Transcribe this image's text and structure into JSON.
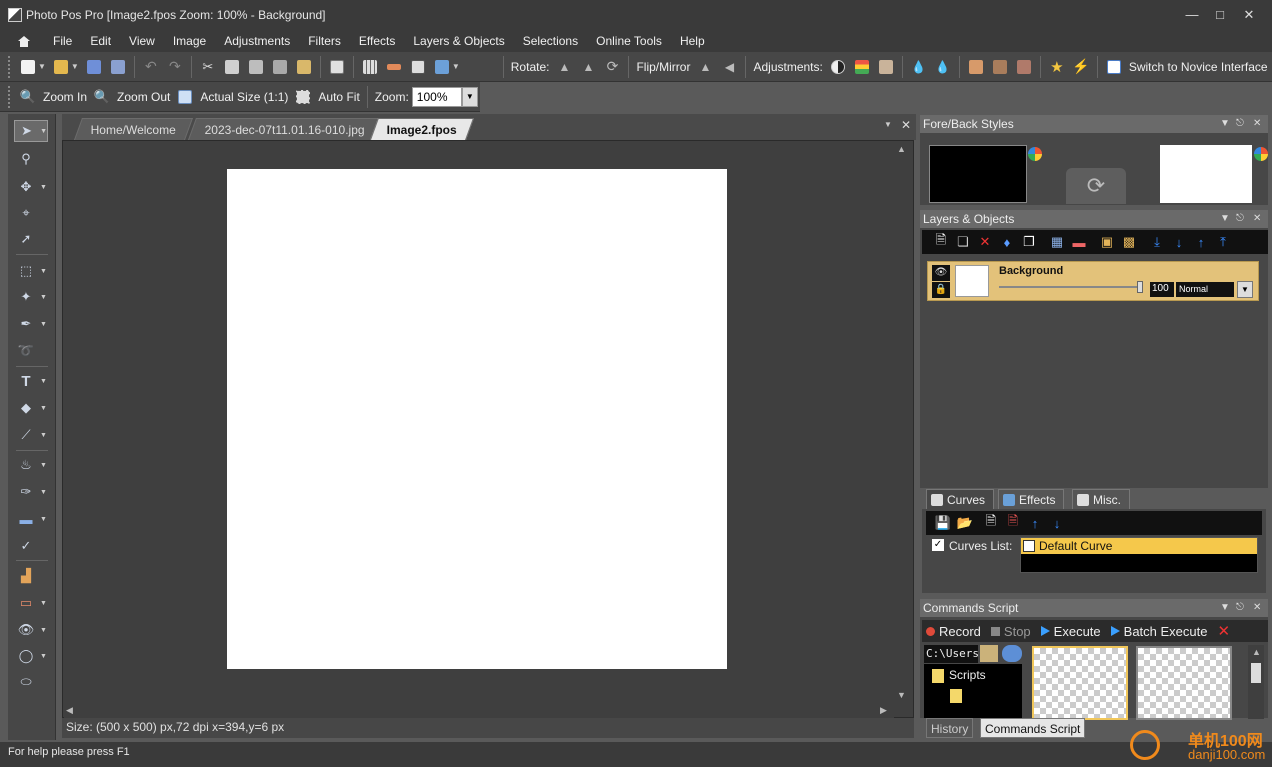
{
  "window": {
    "title": "Photo Pos Pro [Image2.fpos Zoom: 100% - Background]",
    "controls": [
      "minimize",
      "maximize",
      "close"
    ]
  },
  "menu": [
    "File",
    "Edit",
    "View",
    "Image",
    "Adjustments",
    "Filters",
    "Effects",
    "Layers & Objects",
    "Selections",
    "Online Tools",
    "Help"
  ],
  "toolbar1": {
    "rotate_label": "Rotate:",
    "flip_label": "Flip/Mirror",
    "adjustments_label": "Adjustments:",
    "switch_label": "Switch to Novice Interface"
  },
  "toolbar2": {
    "zoom_in": "Zoom In",
    "zoom_out": "Zoom Out",
    "actual_size": "Actual Size (1:1)",
    "auto_fit": "Auto Fit",
    "zoom_label": "Zoom:",
    "zoom_value": "100%"
  },
  "doc_tabs": [
    "Home/Welcome",
    "2023-dec-07t11.01.16-010.jpg",
    "Image2.fpos"
  ],
  "active_doc_tab": "Image2.fpos",
  "doc_status": "Size: (500 x 500) px,72 dpi   x=394,y=6 px",
  "panels": {
    "foreback": {
      "title": "Fore/Back Styles",
      "fore_color": "#000000",
      "back_color": "#ffffff"
    },
    "layers": {
      "title": "Layers & Objects",
      "layer_name": "Background",
      "opacity": "100",
      "blend_mode": "Normal"
    },
    "bottom_tabs": [
      "Curves",
      "Effects",
      "Misc."
    ],
    "curves": {
      "list_label": "Curves List:",
      "items": [
        "Default Curve"
      ]
    },
    "commands": {
      "title": "Commands Script",
      "record": "Record",
      "stop": "Stop",
      "execute": "Execute",
      "batch_execute": "Batch Execute",
      "path": "C:\\Users",
      "tree_root": "Scripts"
    },
    "right_tabs": [
      "History",
      "Commands Script"
    ],
    "active_right_tab": "Commands Script"
  },
  "statusbar": "For help please press F1",
  "watermark": {
    "line1": "单机100网",
    "line2": "danji100.com"
  },
  "colors": {
    "accent": "#e3c27a",
    "selected_item": "#f5c84b",
    "canvas": "#ffffff"
  }
}
